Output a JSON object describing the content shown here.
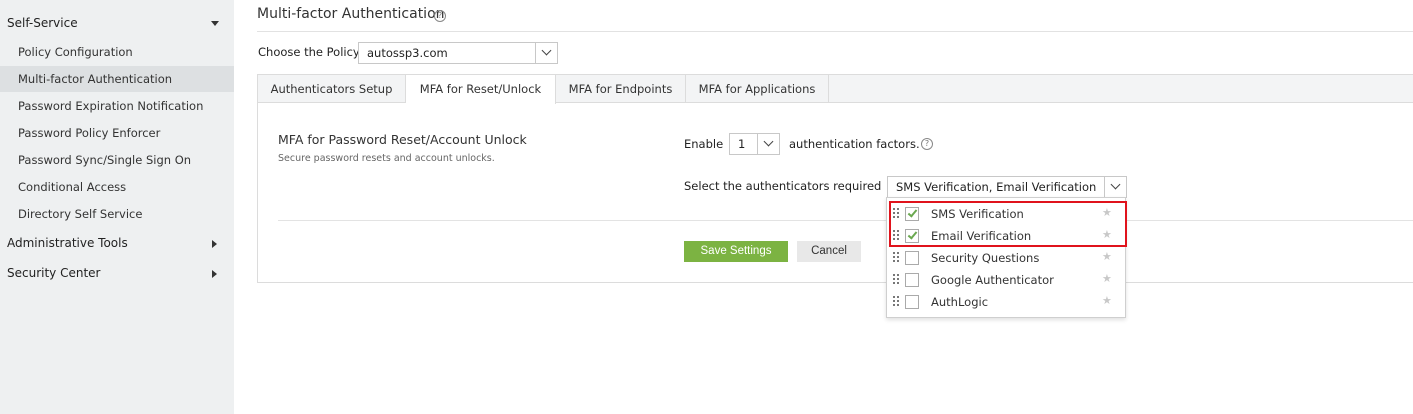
{
  "sidebar": {
    "sections": [
      {
        "label": "Self-Service",
        "expanded": true
      },
      {
        "label": "Administrative Tools",
        "expanded": false
      },
      {
        "label": "Security Center",
        "expanded": false
      }
    ],
    "items": [
      {
        "label": "Policy Configuration",
        "active": false
      },
      {
        "label": "Multi-factor Authentication",
        "active": true
      },
      {
        "label": "Password Expiration Notification",
        "active": false
      },
      {
        "label": "Password Policy Enforcer",
        "active": false
      },
      {
        "label": "Password Sync/Single Sign On",
        "active": false
      },
      {
        "label": "Conditional Access",
        "active": false
      },
      {
        "label": "Directory Self Service",
        "active": false
      }
    ]
  },
  "page": {
    "title": "Multi-factor Authentication",
    "help_glyph": "?"
  },
  "policy": {
    "label": "Choose the Policy",
    "value": "autossp3.com"
  },
  "tabs": [
    {
      "label": "Authenticators Setup",
      "active": false
    },
    {
      "label": "MFA for Reset/Unlock",
      "active": true
    },
    {
      "label": "MFA for Endpoints",
      "active": false
    },
    {
      "label": "MFA for Applications",
      "active": false
    }
  ],
  "section": {
    "title": "MFA for Password Reset/Account Unlock",
    "subtitle": "Secure password resets and account unlocks."
  },
  "factors": {
    "enable_label": "Enable",
    "count_value": "1",
    "suffix_label": "authentication factors.",
    "help_glyph": "?"
  },
  "authenticators": {
    "label": "Select the authenticators required",
    "selected_value": "SMS Verification, Email Verification",
    "options": [
      {
        "label": "SMS Verification",
        "checked": true
      },
      {
        "label": "Email Verification",
        "checked": true
      },
      {
        "label": "Security Questions",
        "checked": false
      },
      {
        "label": "Google Authenticator",
        "checked": false
      },
      {
        "label": "AuthLogic",
        "checked": false
      }
    ],
    "star_glyph": "★"
  },
  "buttons": {
    "save": "Save Settings",
    "cancel": "Cancel"
  },
  "colors": {
    "save_button": "#7cb342",
    "highlight": "#e0131c",
    "sidebar_bg": "#eef0f1",
    "check": "#6aa84f"
  }
}
